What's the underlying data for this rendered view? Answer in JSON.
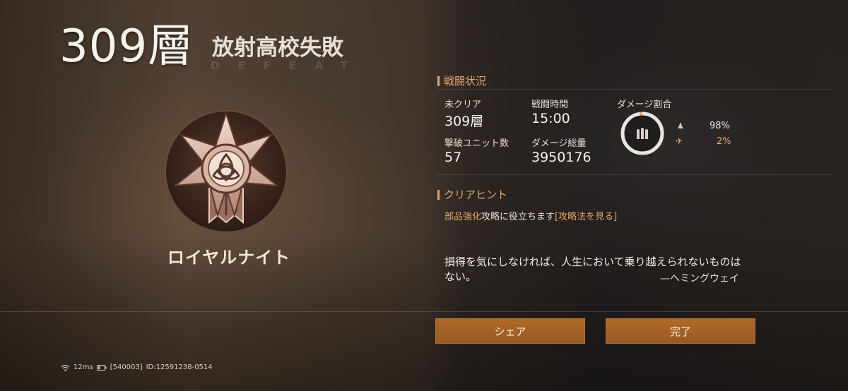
{
  "header": {
    "floor": "309層",
    "subtitle": "放射高校失敗",
    "watermark": "DEFEAT"
  },
  "rank": {
    "name": "ロイヤルナイト",
    "emblem_icon": "royal-knight-emblem"
  },
  "battle": {
    "heading": "戦闘状況",
    "uncleared_label": "未クリア",
    "uncleared_value": "309層",
    "time_label": "戦闘時間",
    "time_value": "15:00",
    "kills_label": "撃破ユニット数",
    "kills_value": "57",
    "damage_total_label": "ダメージ総量",
    "damage_total_value": "3950176",
    "damage_ratio_label": "ダメージ割合",
    "damage_ratio": [
      {
        "icon": "player-icon",
        "percent_text": "98%",
        "percent": 98,
        "color": "#e8e4df"
      },
      {
        "icon": "drone-icon",
        "percent_text": "2%",
        "percent": 2,
        "color": "#e2a66b"
      }
    ]
  },
  "hint": {
    "heading": "クリアヒント",
    "highlight": "部品強化",
    "text": "攻略に役立ちます",
    "link": "[攻略法を見る]"
  },
  "quote": {
    "text": "損得を気にしなければ、人生において乗り越えられないものはない。",
    "author": "—ヘミングウェイ"
  },
  "buttons": {
    "share": "シェア",
    "done": "完了"
  },
  "status_bar": {
    "ping": "12ms",
    "server": "[540003]",
    "user_id": "ID:12591238-0514"
  },
  "colors": {
    "accent": "#e2a66b",
    "button": "#a8632a"
  }
}
